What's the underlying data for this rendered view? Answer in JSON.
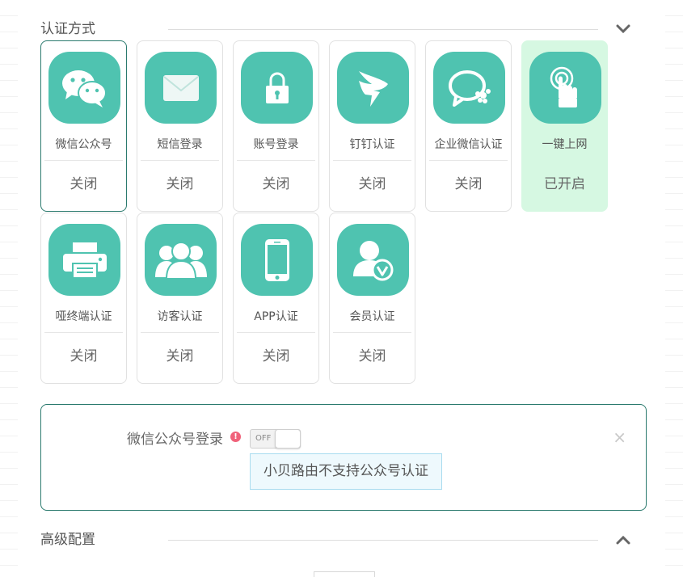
{
  "auth_section": {
    "title": "认证方式",
    "collapse_icon": "chevron-down-icon"
  },
  "auth_methods": [
    {
      "label": "微信公众号",
      "status": "关闭",
      "icon": "wechat-icon",
      "state": "selected"
    },
    {
      "label": "短信登录",
      "status": "关闭",
      "icon": "envelope-icon",
      "state": "normal"
    },
    {
      "label": "账号登录",
      "status": "关闭",
      "icon": "lock-icon",
      "state": "normal"
    },
    {
      "label": "钉钉认证",
      "status": "关闭",
      "icon": "dingtalk-icon",
      "state": "normal"
    },
    {
      "label": "企业微信认证",
      "status": "关闭",
      "icon": "enterprise-wechat-icon",
      "state": "normal"
    },
    {
      "label": "一键上网",
      "status": "已开启",
      "icon": "tap-finger-icon",
      "state": "active"
    },
    {
      "label": "哑终端认证",
      "status": "关闭",
      "icon": "printer-icon",
      "state": "normal"
    },
    {
      "label": "访客认证",
      "status": "关闭",
      "icon": "visitors-icon",
      "state": "normal"
    },
    {
      "label": "APP认证",
      "status": "关闭",
      "icon": "phone-icon",
      "state": "normal"
    },
    {
      "label": "会员认证",
      "status": "关闭",
      "icon": "member-icon",
      "state": "normal"
    }
  ],
  "config_panel": {
    "label": "微信公众号登录",
    "info_icon": "!",
    "toggle_text": "OFF",
    "toggle_on": false,
    "notice": "小贝路由不支持公众号认证",
    "close_label": "×"
  },
  "advanced_section": {
    "title": "高级配置",
    "collapse_icon": "chevron-up-icon"
  },
  "colors": {
    "accent": "#4fc3b0",
    "selected_border": "#2b7a6e",
    "active_bg": "#d6f8e2",
    "notice_bg": "#eef9fd",
    "notice_border": "#a9dcef",
    "info": "#f0627a"
  }
}
